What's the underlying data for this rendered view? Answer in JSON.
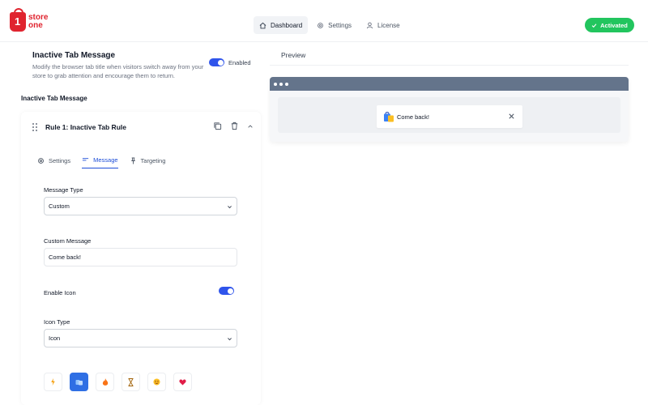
{
  "brand": {
    "line1": "store",
    "line2": "one",
    "mark": "1"
  },
  "nav": {
    "dashboard": "Dashboard",
    "settings": "Settings",
    "license": "License"
  },
  "status_badge": "Activated",
  "header": {
    "title": "Inactive Tab Message",
    "description": "Modify the browser tab title when visitors switch away from your store to grab attention and encourage them to return.",
    "toggle_label": "Enabled",
    "toggle_on": true
  },
  "section_label": "Inactive Tab Message",
  "rule": {
    "title": "Rule 1: Inactive Tab Rule",
    "tabs": [
      "Settings",
      "Message",
      "Targeting"
    ],
    "active_tab": "Message"
  },
  "form": {
    "message_type_label": "Message Type",
    "message_type_value": "Custom",
    "custom_message_label": "Custom Message",
    "custom_message_value": "Come back!",
    "enable_icon_label": "Enable Icon",
    "enable_icon_on": true,
    "icon_type_label": "Icon Type",
    "icon_type_value": "Icon",
    "icons": [
      "lightning-icon",
      "shopping-bags-icon",
      "fire-icon",
      "hourglass-icon",
      "smiley-icon",
      "heart-icon"
    ],
    "selected_icon": "shopping-bags-icon"
  },
  "preview": {
    "label": "Preview",
    "tab_text": "Come back!"
  },
  "colors": {
    "brand": "#e0242f",
    "accent": "#2f54eb",
    "success": "#22c55e",
    "browser_bar": "#64748b"
  }
}
